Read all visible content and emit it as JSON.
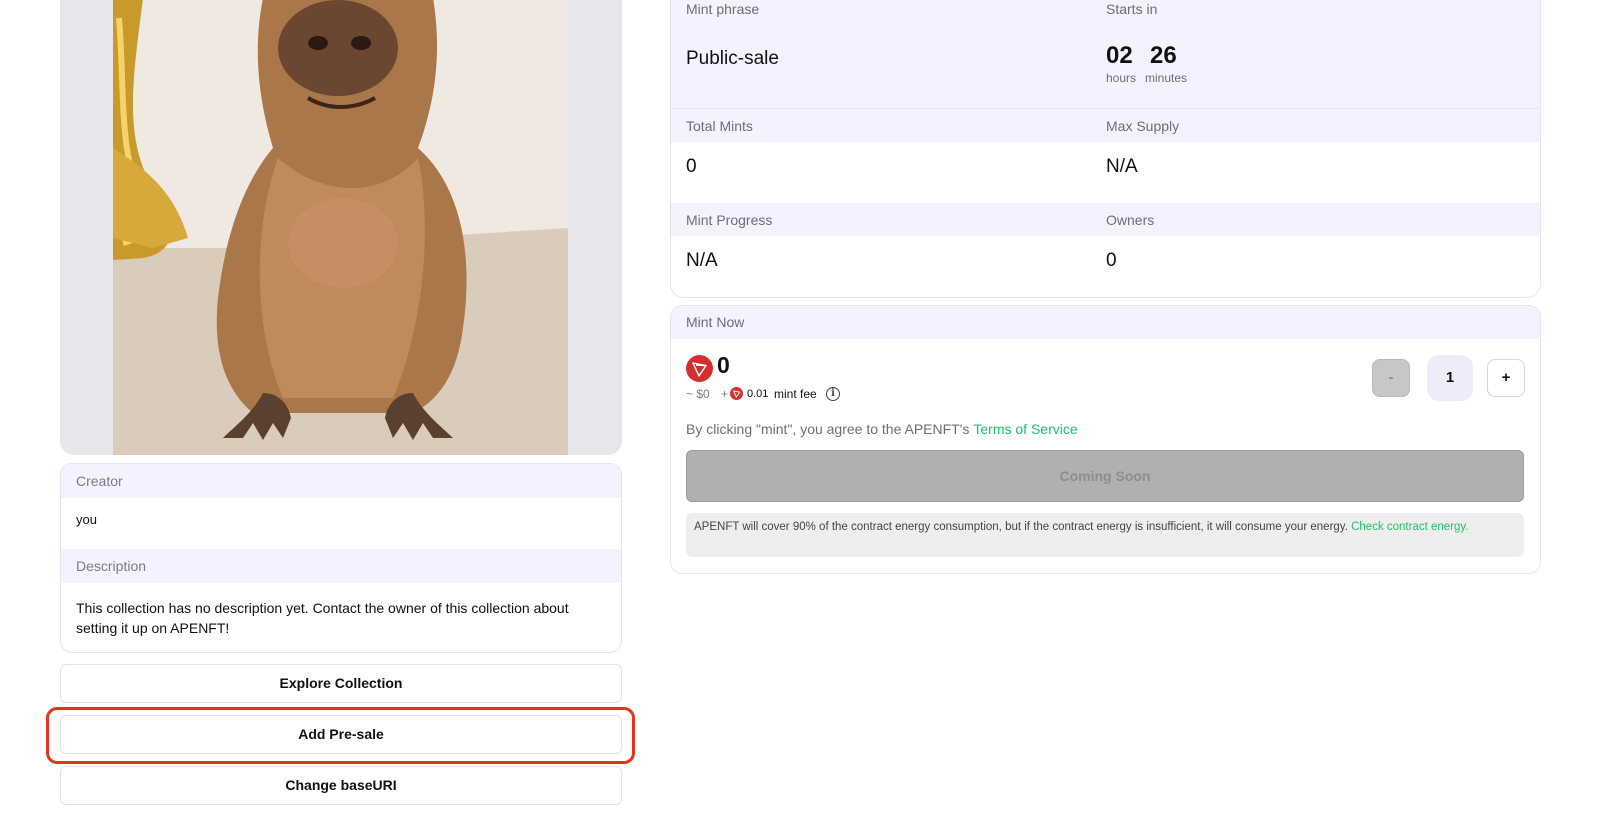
{
  "collection": {
    "creator_label": "Creator",
    "creator_value": "you",
    "description_label": "Description",
    "description_text": "This collection has no description yet. Contact the owner of this collection about setting it up on APENFT!"
  },
  "actions": {
    "explore": "Explore Collection",
    "add_presale": "Add Pre-sale",
    "change_base_uri": "Change baseURI"
  },
  "stats": {
    "mint_phrase_label": "Mint phrase",
    "mint_phrase_value": "Public-sale",
    "starts_in_label": "Starts in",
    "countdown": {
      "hours": "02",
      "hours_label": "hours",
      "minutes": "26",
      "minutes_label": "minutes"
    },
    "total_mints_label": "Total Mints",
    "total_mints_value": "0",
    "max_supply_label": "Max Supply",
    "max_supply_value": "N/A",
    "mint_progress_label": "Mint Progress",
    "mint_progress_value": "N/A",
    "owners_label": "Owners",
    "owners_value": "0"
  },
  "mint": {
    "header": "Mint Now",
    "price": "0",
    "usd": "~ $0",
    "plus": "+",
    "fee_amount": "0.01",
    "fee_label": "mint fee",
    "minus_label": "-",
    "quantity": "1",
    "plus_label": "+",
    "agree_text": "By clicking \"mint\", you agree to the APENFT's",
    "tos_link": "Terms of Service",
    "button_label": "Coming Soon",
    "energy_note": "APENFT will cover 90% of the contract energy consumption, but if the contract energy is insufficient, it will consume your energy.",
    "energy_link": "Check contract energy."
  },
  "icons": {
    "token": "tron-icon",
    "info": "info-icon"
  },
  "colors": {
    "accent_green": "#1ec26a",
    "header_band": "#f3f3ff",
    "highlight_red": "#e8321f",
    "tron_red": "#d32f2f"
  }
}
